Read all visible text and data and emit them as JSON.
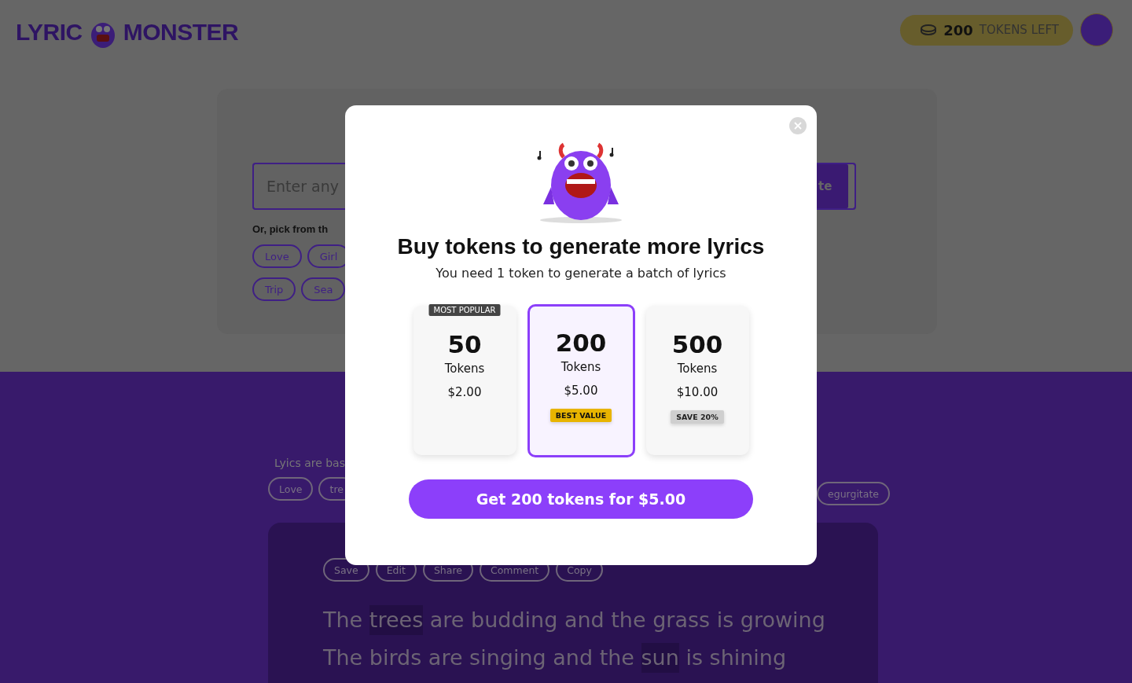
{
  "header": {
    "logo_left": "LYRIC",
    "logo_right": "MONSTER",
    "tokens": {
      "count": "200",
      "label": "TOKENS LEFT"
    }
  },
  "prompt_card": {
    "input": {
      "placeholder": "Enter any"
    },
    "generate_button": "te",
    "pick_label": "Or, pick from th",
    "tag_rows": [
      [
        "Love",
        "Girl"
      ],
      [
        "Trip",
        "Sea"
      ]
    ]
  },
  "results": {
    "note": "Lyics are bas",
    "tags_left": [
      "Love",
      "tre"
    ],
    "tags_right": [
      "egurgitate"
    ],
    "actions": [
      "Save",
      "Edit",
      "Share",
      "Comment",
      "Copy"
    ],
    "lines": [
      [
        {
          "text": "The ",
          "highlighted": false
        },
        {
          "text": "trees",
          "highlighted": true
        },
        {
          "text": " are budding and the grass is growing",
          "highlighted": false
        }
      ],
      [
        {
          "text": "The birds are singing and the ",
          "highlighted": false
        },
        {
          "text": "sun",
          "highlighted": true
        },
        {
          "text": " is shining",
          "highlighted": false
        }
      ]
    ]
  },
  "modal": {
    "title": "Buy tokens to generate more lyrics",
    "subtitle": "You need 1 token to generate a batch of lyrics",
    "plans": [
      {
        "amount": "50",
        "unit": "Tokens",
        "price": "$2.00",
        "selected": false,
        "ribbon": "MOST POPULAR"
      },
      {
        "amount": "200",
        "unit": "Tokens",
        "price": "$5.00",
        "selected": true,
        "badge": {
          "text": "BEST VALUE",
          "kind": "highlight"
        }
      },
      {
        "amount": "500",
        "unit": "Tokens",
        "price": "$10.00",
        "selected": false,
        "badge": {
          "text": "SAVE 20%",
          "kind": "neutral"
        }
      }
    ],
    "cta": "Get 200 tokens for $5.00"
  }
}
